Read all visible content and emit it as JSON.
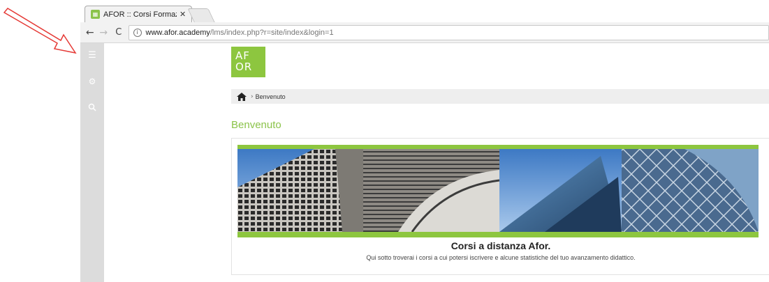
{
  "browser": {
    "tab_title": "AFOR :: Corsi Formazione",
    "tab_close": "✕",
    "url_host": "www.afor.academy",
    "url_path": "/lms/index.php?r=site/index&login=1"
  },
  "sidebar": {
    "icons": [
      "menu-icon",
      "gears-icon",
      "search-icon"
    ]
  },
  "logo": {
    "line1": "AF",
    "line2": "OR"
  },
  "breadcrumb": {
    "current": "Benvenuto"
  },
  "page": {
    "heading": "Benvenuto",
    "card_title": "Corsi a distanza Afor.",
    "card_subtitle": "Qui sotto troverai i corsi a cui potersi iscrivere e alcune statistiche del tuo avanzamento didattico."
  },
  "colors": {
    "brand_green": "#8dc63f",
    "sidebar_gray": "#dcdcdc",
    "annotation_red": "#e53935"
  }
}
